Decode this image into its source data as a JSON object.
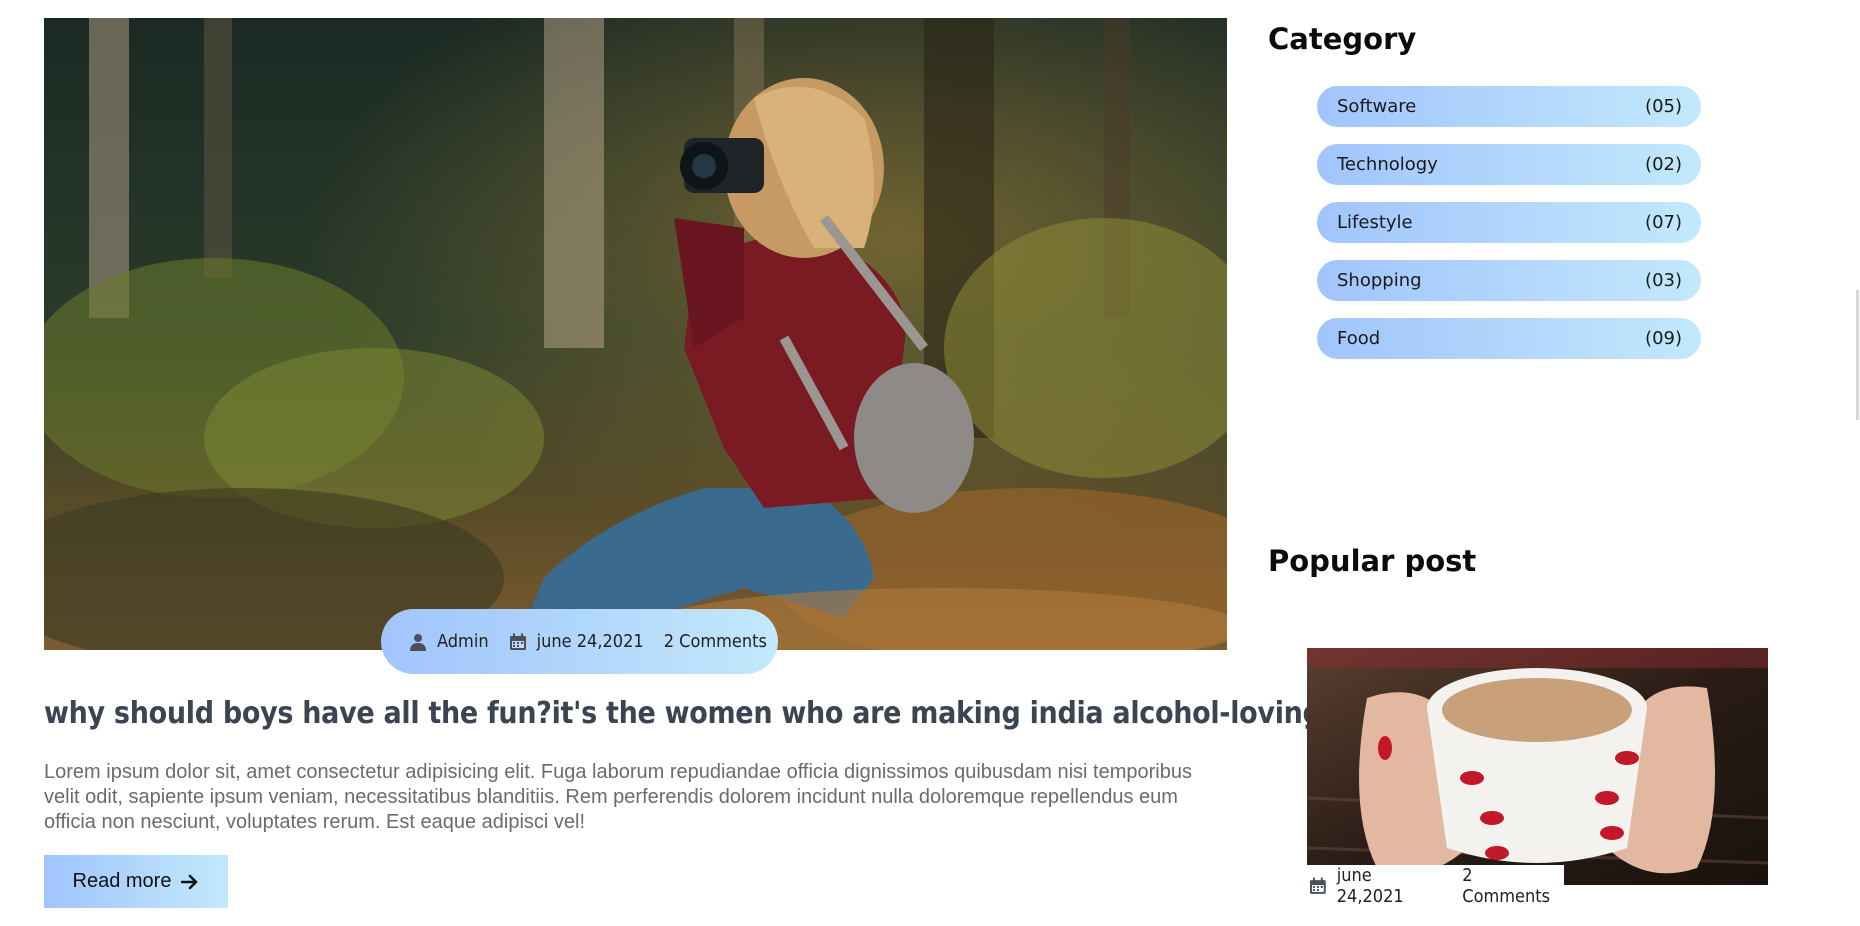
{
  "main_post": {
    "image_alt": "Woman with camera sitting in forest",
    "meta": {
      "author": "Admin",
      "date": "june 24,2021",
      "comments": "2 Comments"
    },
    "title": "why should boys have all the fun?it's the women who are making india alcohol-loving-country",
    "excerpt": "Lorem ipsum dolor sit, amet consectetur adipisicing elit. Fuga laborum repudiandae officia dignissimos quibusdam nisi temporibus velit odit, sapiente ipsum veniam, necessitatibus blanditiis. Rem perferendis dolorem incidunt nulla doloremque repellendus eum officia non nesciunt, voluptates rerum. Est eaque adipisci vel!",
    "read_more_label": "Read more"
  },
  "sidebar": {
    "category_title": "Category",
    "categories": [
      {
        "name": "Software",
        "count": "(05)"
      },
      {
        "name": "Technology",
        "count": "(02)"
      },
      {
        "name": "Lifestyle",
        "count": "(07)"
      },
      {
        "name": "Shopping",
        "count": "(03)"
      },
      {
        "name": "Food",
        "count": "(09)"
      }
    ],
    "popular_title": "Popular post",
    "popular_post": {
      "image_alt": "Hands holding a cup of coffee",
      "date": "june 24,2021",
      "comments": "2 Comments"
    }
  },
  "colors": {
    "gradient_start": "#a1c4fd",
    "gradient_end": "#c2e9fb",
    "title_color": "#3a4452",
    "excerpt_color": "#6b6b6b"
  },
  "icons": {
    "author": "user-icon",
    "date": "calendar-icon",
    "read_more": "arrow-right-icon"
  }
}
